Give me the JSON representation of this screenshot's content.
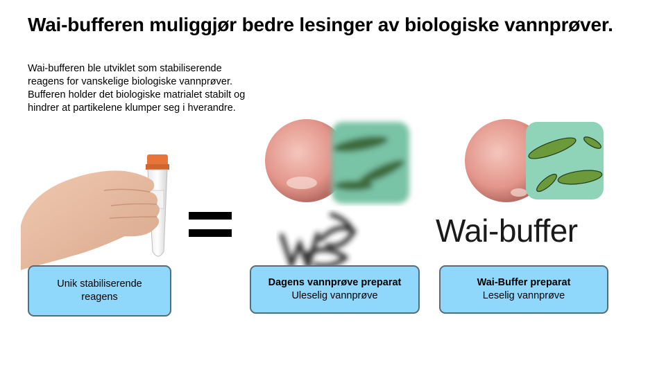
{
  "title": "Wai-bufferen muliggjør bedre lesinger av biologiske vannprøver.",
  "intro": "Wai-bufferen ble utviklet som stabiliserende reagens for vanskelige biologiske vannprøver. Bufferen holder det biologiske matrialet stabilt og hindrer at partikelene klumper seg i hverandre.",
  "logo_text": "Wai-buffer",
  "boxes": {
    "reagent": {
      "line1": "Unik stabiliserende",
      "line2": "reagens"
    },
    "current": {
      "title": "Dagens vannprøve preparat",
      "subtitle": "Uleselig vannprøve"
    },
    "wai": {
      "title": "Wai-Buffer preparat",
      "subtitle": "Leselig vannprøve"
    }
  },
  "colors": {
    "box_fill": "#8fd8fb",
    "box_border": "#5a6b78",
    "sphere": "#e8a59b",
    "bacteria_bg": "#79c3a6",
    "bacteria": "#3d6b3a"
  },
  "icons": {
    "equals": "equals-sign-icon"
  }
}
